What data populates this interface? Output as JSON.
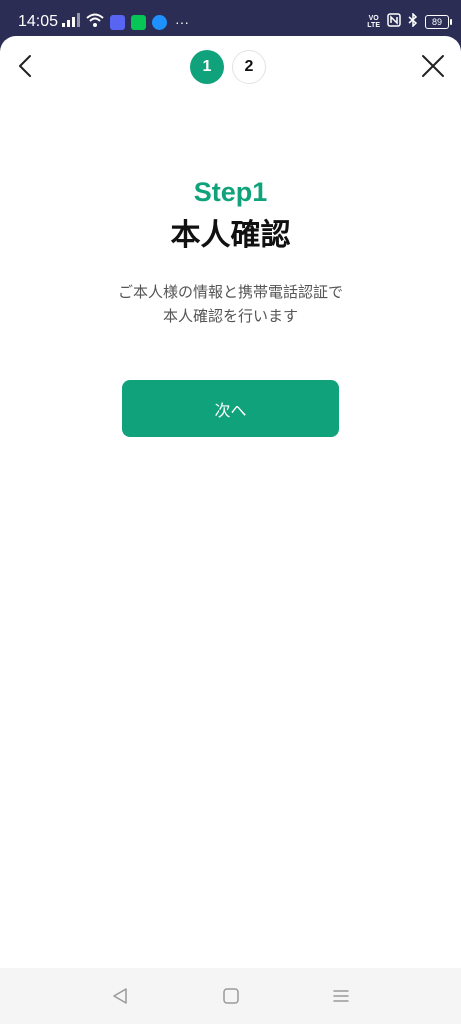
{
  "status_bar": {
    "time": "14:05",
    "volte_top": "VO",
    "volte_bottom": "LTE",
    "battery": "89",
    "more": "···",
    "app_icons": [
      {
        "name": "discord-icon",
        "color": "#5865f2"
      },
      {
        "name": "line-icon",
        "color": "#06c755"
      },
      {
        "name": "app-icon",
        "color": "#1e90ff"
      }
    ]
  },
  "header": {
    "steps": [
      "1",
      "2"
    ],
    "active_step": "1"
  },
  "content": {
    "step_label": "Step1",
    "title": "本人確認",
    "description_line1": "ご本人様の情報と携帯電話認証で",
    "description_line2": "本人確認を行います",
    "next_button": "次へ"
  },
  "colors": {
    "accent": "#10a37b",
    "status_bar": "#2b2d55"
  }
}
